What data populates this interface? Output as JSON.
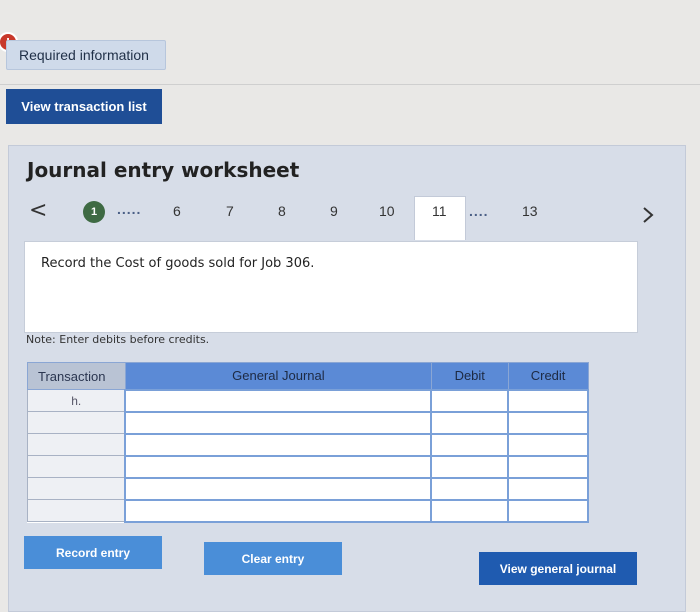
{
  "required_info": {
    "icon": "!",
    "label": "Required information"
  },
  "view_transaction_list_label": "View transaction list",
  "worksheet": {
    "title": "Journal entry worksheet",
    "nav": {
      "prev": "<",
      "current_step": "1",
      "steps": [
        "6",
        "7",
        "8",
        "9",
        "10",
        "11",
        "13"
      ],
      "dots": "....."
    },
    "instruction": "Record the Cost of goods sold for Job 306.",
    "note": "Note: Enter debits before credits.",
    "table": {
      "headers": {
        "transaction": "Transaction",
        "general_journal": "General Journal",
        "debit": "Debit",
        "credit": "Credit"
      },
      "first_row_transaction": "h."
    },
    "buttons": {
      "record": "Record entry",
      "clear": "Clear entry",
      "view_general_journal": "View general journal"
    }
  }
}
